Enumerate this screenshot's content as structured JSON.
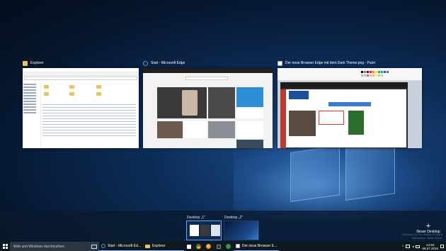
{
  "task_view": {
    "windows": [
      {
        "title": "Explorer",
        "icon": "folder-icon"
      },
      {
        "title": "Start - Microsoft Edge",
        "icon": "edge-icon"
      },
      {
        "title": "Der neue Browser Edge mit dem Dark Theme.png - Paint",
        "icon": "paint-icon"
      }
    ]
  },
  "desktops": {
    "items": [
      {
        "label": "Desktop „1\""
      },
      {
        "label": "Desktop „2\""
      }
    ],
    "new_desktop_label": "Neuer Desktop"
  },
  "watermark": {
    "line1": "Windows 10 Pro Insider Preview",
    "line2": "Testversion. Build 10162"
  },
  "taskbar": {
    "search_placeholder": "Web und Windows durchsuchen",
    "tasks": [
      {
        "label": "Start - Microsoft Ed...",
        "icon": "edge-icon"
      },
      {
        "label": "Explorer",
        "icon": "folder-icon"
      },
      {
        "label": "Der neue Browser E...",
        "icon": "paint-icon"
      }
    ],
    "pinned_icons": [
      "store-icon",
      "chrome-icon",
      "firefox-icon",
      "media-player-icon",
      "xbox-icon"
    ],
    "tray_icons": [
      "chevron-up-icon",
      "network-icon",
      "volume-icon",
      "keyboard-icon",
      "notification-icon"
    ],
    "clock_time": "14:50",
    "clock_date": "06.07.2015"
  },
  "colors": {
    "accent": "#5ea7ff",
    "taskbar": "#101820",
    "wallpaper": "#0c2c57"
  }
}
